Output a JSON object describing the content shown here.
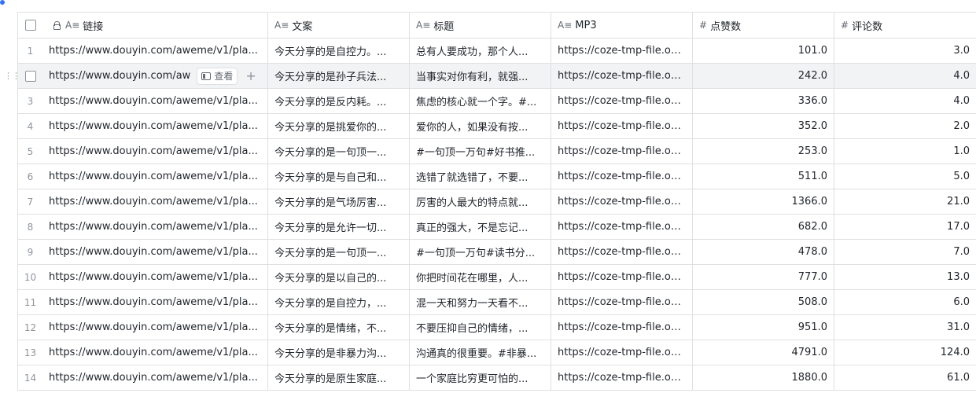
{
  "table": {
    "columns": [
      {
        "key": "link",
        "icon": "text-field-icon",
        "label": "链接",
        "locked": true
      },
      {
        "key": "copy",
        "icon": "text-field-icon",
        "label": "文案"
      },
      {
        "key": "title",
        "icon": "text-field-icon",
        "label": "标题"
      },
      {
        "key": "mp3",
        "icon": "text-field-icon",
        "label": "MP3"
      },
      {
        "key": "likes",
        "icon": "number-field-icon",
        "label": "点赞数"
      },
      {
        "key": "comments",
        "icon": "number-field-icon",
        "label": "评论数"
      }
    ],
    "type_glyphs": {
      "text": "A≡",
      "number": "#"
    },
    "hover_row_actions": {
      "view_label": "查看",
      "add_symbol": "+"
    },
    "rows": [
      {
        "index": "1",
        "link": "https://www.douyin.com/aweme/v1/pla...",
        "copy": "今天分享的是自控力。...",
        "title": "总有人要成功，那个人...",
        "mp3": "https://coze-tmp-file.oss...",
        "likes": "101.0",
        "comments": "3.0"
      },
      {
        "index": "2",
        "link": "https://www.douyin.com/aw",
        "copy": "今天分享的是孙子兵法...",
        "title": "当事实对你有利，就强...",
        "mp3": "https://coze-tmp-file.oss...",
        "likes": "242.0",
        "comments": "4.0",
        "hover": true
      },
      {
        "index": "3",
        "link": "https://www.douyin.com/aweme/v1/pla...",
        "copy": "今天分享的是反内耗。...",
        "title": "焦虑的核心就一个字。#...",
        "mp3": "https://coze-tmp-file.oss...",
        "likes": "336.0",
        "comments": "4.0"
      },
      {
        "index": "4",
        "link": "https://www.douyin.com/aweme/v1/pla...",
        "copy": "今天分享的是挑爱你的...",
        "title": "爱你的人，如果没有按...",
        "mp3": "https://coze-tmp-file.oss...",
        "likes": "352.0",
        "comments": "2.0"
      },
      {
        "index": "5",
        "link": "https://www.douyin.com/aweme/v1/pla...",
        "copy": "今天分享的是一句顶一...",
        "title": "#一句顶一万句#好书推...",
        "mp3": "https://coze-tmp-file.oss...",
        "likes": "253.0",
        "comments": "1.0"
      },
      {
        "index": "6",
        "link": "https://www.douyin.com/aweme/v1/pla...",
        "copy": "今天分享的是与自己和...",
        "title": "选错了就选错了，不要...",
        "mp3": "https://coze-tmp-file.oss...",
        "likes": "511.0",
        "comments": "5.0"
      },
      {
        "index": "7",
        "link": "https://www.douyin.com/aweme/v1/pla...",
        "copy": "今天分享的是气场厉害...",
        "title": "厉害的人最大的特点就...",
        "mp3": "https://coze-tmp-file.oss...",
        "likes": "1366.0",
        "comments": "21.0"
      },
      {
        "index": "8",
        "link": "https://www.douyin.com/aweme/v1/pla...",
        "copy": "今天分享的是允许一切...",
        "title": "真正的强大，不是忘记...",
        "mp3": "https://coze-tmp-file.oss...",
        "likes": "682.0",
        "comments": "17.0"
      },
      {
        "index": "9",
        "link": "https://www.douyin.com/aweme/v1/pla...",
        "copy": "今天分享的是一句顶一...",
        "title": "#一句顶一万句#读书分...",
        "mp3": "https://coze-tmp-file.oss...",
        "likes": "478.0",
        "comments": "7.0"
      },
      {
        "index": "10",
        "link": "https://www.douyin.com/aweme/v1/pla...",
        "copy": "今天分享的是以自己的...",
        "title": "你把时间花在哪里，人...",
        "mp3": "https://coze-tmp-file.oss...",
        "likes": "777.0",
        "comments": "13.0"
      },
      {
        "index": "11",
        "link": "https://www.douyin.com/aweme/v1/pla...",
        "copy": "今天分享的是自控力，...",
        "title": "混一天和努力一天看不...",
        "mp3": "https://coze-tmp-file.oss...",
        "likes": "508.0",
        "comments": "6.0"
      },
      {
        "index": "12",
        "link": "https://www.douyin.com/aweme/v1/pla...",
        "copy": "今天分享的是情绪，不...",
        "title": "不要压抑自己的情绪，...",
        "mp3": "https://coze-tmp-file.oss...",
        "likes": "951.0",
        "comments": "31.0"
      },
      {
        "index": "13",
        "link": "https://www.douyin.com/aweme/v1/pla...",
        "copy": "今天分享的是非暴力沟...",
        "title": "沟通真的很重要。#非暴...",
        "mp3": "https://coze-tmp-file.oss...",
        "likes": "4791.0",
        "comments": "124.0"
      },
      {
        "index": "14",
        "link": "https://www.douyin.com/aweme/v1/pla...",
        "copy": "今天分享的是原生家庭...",
        "title": "一个家庭比穷更可怕的...",
        "mp3": "https://coze-tmp-file.oss...",
        "likes": "1880.0",
        "comments": "61.0"
      }
    ]
  },
  "colors": {
    "border": "#dee0e3",
    "hover_row": "#f2f3f5",
    "muted_text": "#8f959e",
    "accent": "#3370ff"
  }
}
